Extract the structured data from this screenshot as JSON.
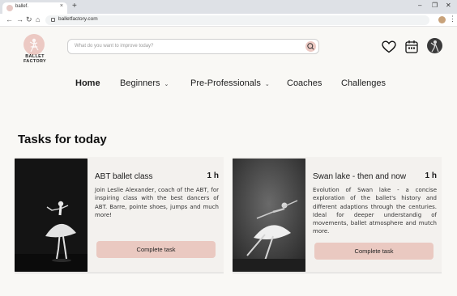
{
  "browser": {
    "tab_title": "ballef.",
    "tab_close": "×",
    "new_tab": "+",
    "url": "balletfactory.com",
    "controls": [
      "–",
      "❐",
      "✕"
    ]
  },
  "header": {
    "logo_text": "BALLET FACTORY",
    "search_placeholder": "What do you want to improve today?",
    "icons": [
      "favorite-heart-icon",
      "calendar-icon",
      "profile-avatar"
    ]
  },
  "nav": {
    "items": [
      {
        "label": "Home",
        "active": true,
        "has_dropdown": false
      },
      {
        "label": "Beginners",
        "active": false,
        "has_dropdown": true
      },
      {
        "label": "Pre-Professionals",
        "active": false,
        "has_dropdown": true
      },
      {
        "label": "Coaches",
        "active": false,
        "has_dropdown": false
      },
      {
        "label": "Challenges",
        "active": false,
        "has_dropdown": false
      }
    ]
  },
  "main": {
    "section_title": "Tasks for today",
    "cards": [
      {
        "title": "ABT ballet class",
        "duration": "1 h",
        "description": "Join Leslie Alexander, coach of the ABT, for inspiring class with the best dancers of ABT. Barre, pointe shoes, jumps and much more!",
        "button": "Complete task"
      },
      {
        "title": "Swan lake - then and now",
        "duration": "1 h",
        "description": "Evolution of Swan lake - a concise exploration of the ballet's history and different adaptions through the centuries. Ideal for deeper understandig of movements, ballet atmosphere and mutch more.",
        "button": "Complete task"
      }
    ]
  },
  "colors": {
    "accent": "#eac9c1",
    "background": "#f9f8f5",
    "card_bg": "#f3f1ee"
  }
}
